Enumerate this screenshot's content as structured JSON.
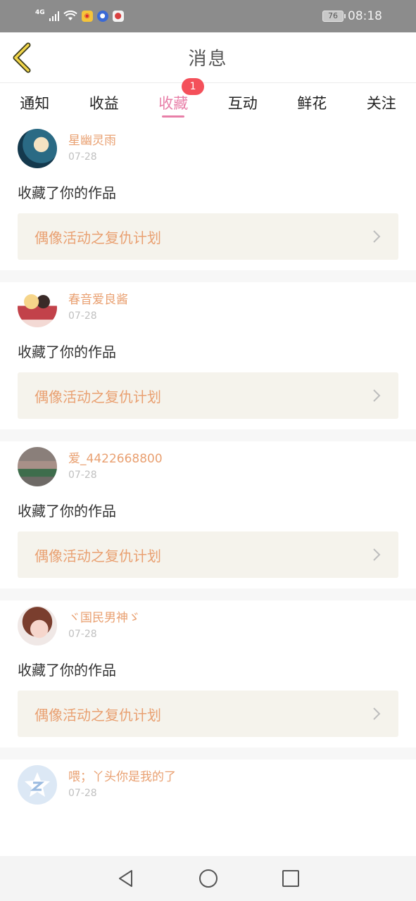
{
  "status_bar": {
    "network": "4G",
    "battery": "76",
    "time": "08:18",
    "icons": [
      "signal-icon",
      "wifi-icon",
      "weibo-icon",
      "app-icon",
      "map-pin-icon"
    ]
  },
  "header": {
    "title": "消息",
    "back_icon": "chevron-left-icon"
  },
  "tabs": [
    {
      "label": "通知",
      "active": false
    },
    {
      "label": "收益",
      "active": false
    },
    {
      "label": "收藏",
      "active": true,
      "badge": "1"
    },
    {
      "label": "互动",
      "active": false
    },
    {
      "label": "鲜花",
      "active": false
    },
    {
      "label": "关注",
      "active": false
    }
  ],
  "feed": {
    "items": [
      {
        "username": "星幽灵雨",
        "date": "07-28",
        "action": "收藏了你的作品",
        "work": "偶像活动之复仇计划"
      },
      {
        "username": "春音爱良酱",
        "date": "07-28",
        "action": "收藏了你的作品",
        "work": "偶像活动之复仇计划"
      },
      {
        "username": "爱_4422668800",
        "date": "07-28",
        "action": "收藏了你的作品",
        "work": "偶像活动之复仇计划"
      },
      {
        "username": "ヾ国民男神ゞ",
        "date": "07-28",
        "action": "收藏了你的作品",
        "work": "偶像活动之复仇计划"
      },
      {
        "username": "喂；丫头你是我的了",
        "date": "07-28",
        "action": "",
        "work": ""
      }
    ]
  },
  "nav_bar": {
    "icons": [
      "back-triangle-icon",
      "home-circle-icon",
      "recents-square-icon"
    ]
  },
  "colors": {
    "accent_pink": "#e87fa8",
    "username_orange": "#e9a071",
    "badge_red": "#f4505a",
    "work_box_bg": "#f5f3ec"
  }
}
